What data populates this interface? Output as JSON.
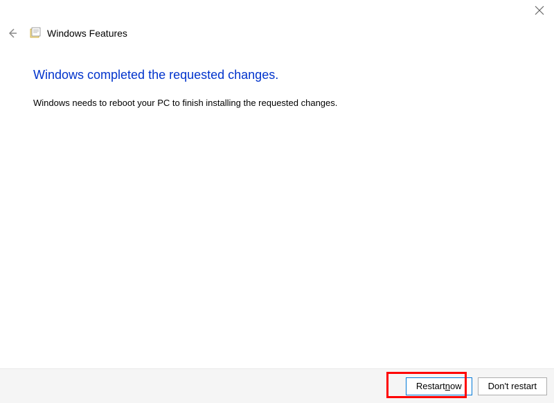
{
  "window": {
    "close_label": "Close"
  },
  "header": {
    "back_label": "Back",
    "title": "Windows Features"
  },
  "content": {
    "heading": "Windows completed the requested changes.",
    "body": "Windows needs to reboot your PC to finish installing the requested changes."
  },
  "footer": {
    "restart_prefix": "Restart ",
    "restart_mnemonic": "n",
    "restart_suffix": "ow",
    "dont_restart_label": "Don't restart"
  },
  "colors": {
    "heading": "#0033cc",
    "primary_button_border": "#0078d7",
    "highlight": "#ff0000"
  }
}
